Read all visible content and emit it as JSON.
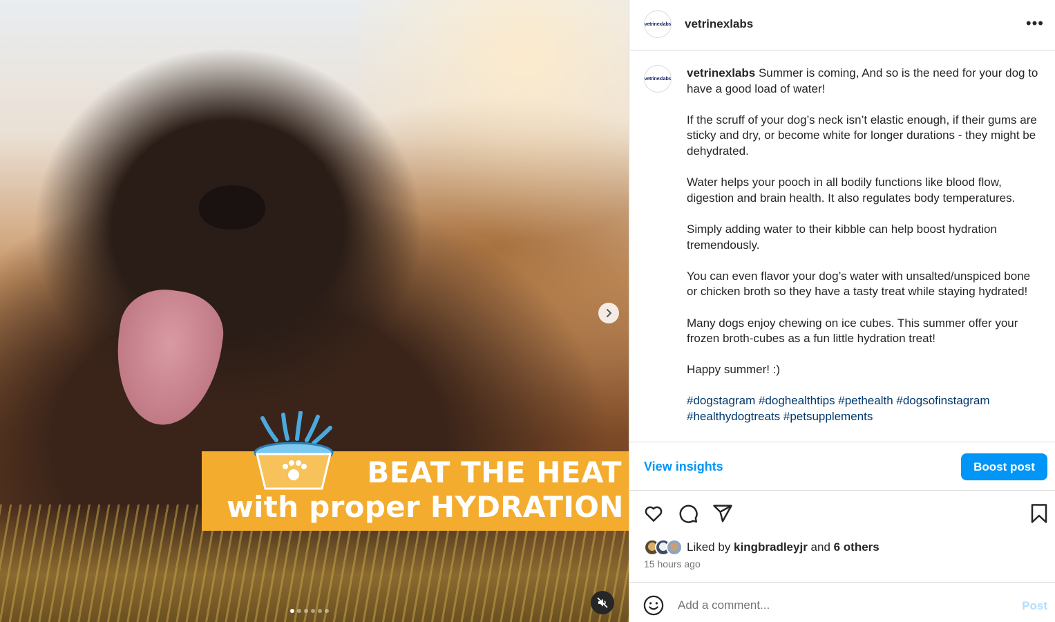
{
  "post": {
    "media": {
      "banner_line1": "BEAT THE HEAT",
      "banner_line2": "with proper HYDRATION",
      "carousel_total": 6,
      "carousel_active": 1
    },
    "header": {
      "avatar_text": "vetrinexlabs",
      "username": "vetrinexlabs",
      "more_label": "•••"
    },
    "caption": {
      "username": "vetrinexlabs",
      "first_line": " Summer is coming, And so is the need for your dog to have a good load of water!",
      "paragraphs": [
        "If the scruff of your dog’s neck isn’t elastic enough, if their gums are sticky and dry, or become white for longer durations - they might be dehydrated.",
        "Water helps your pooch in all bodily functions like blood flow, digestion and brain health. It also regulates body temperatures.",
        "Simply adding water to their kibble can help boost hydration tremendously.",
        "You can even flavor your dog’s water with unsalted/unspiced bone or chicken broth so they have a tasty treat while staying hydrated!",
        "Many dogs enjoy chewing on ice cubes. This summer offer your frozen broth-cubes as a fun little hydration treat!",
        "Happy summer! :)"
      ],
      "hashtags": "#dogstagram #doghealthtips #pethealth #dogsofinstagram #healthydogtreats #petsupplements"
    },
    "insights": {
      "view_label": "View insights",
      "boost_label": "Boost post"
    },
    "likes": {
      "prefix": "Liked by ",
      "user": "kingbradleyjr",
      "middle": " and ",
      "others": "6 others"
    },
    "timestamp": "15 hours ago",
    "comment": {
      "placeholder": "Add a comment...",
      "post_label": "Post"
    }
  },
  "colors": {
    "accent": "#0095f6",
    "banner": "#f4ac2e",
    "hashtag": "#00376b",
    "muted": "#737373"
  }
}
